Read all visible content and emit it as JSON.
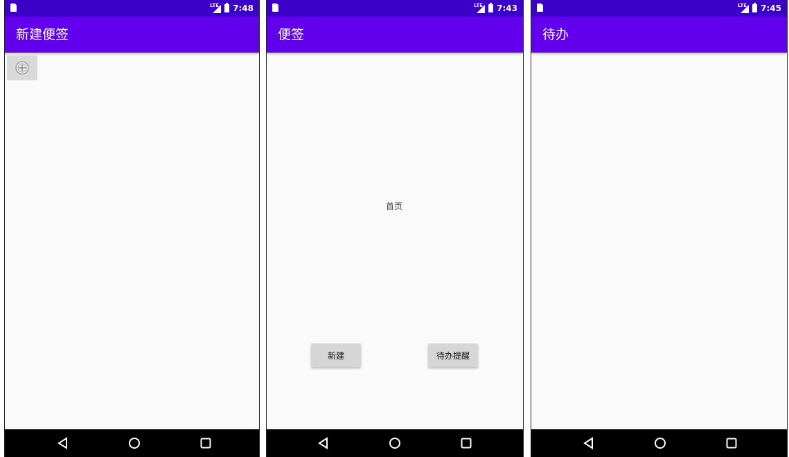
{
  "screens": [
    {
      "status": {
        "time": "7:48",
        "network": "LTE"
      },
      "title": "新建便签",
      "add_icon": "add-circle-icon"
    },
    {
      "status": {
        "time": "7:43",
        "network": "LTE"
      },
      "title": "便签",
      "home_text": "首页",
      "buttons": {
        "new": "新建",
        "todo": "待办提醒"
      }
    },
    {
      "status": {
        "time": "7:45",
        "network": "LTE"
      },
      "title": "待办"
    }
  ],
  "colors": {
    "statusbar": "#3d00c8",
    "appbar": "#6200ee",
    "navbar": "#000000",
    "background": "#fafafa"
  },
  "nav_icons": [
    "back-triangle-icon",
    "home-circle-icon",
    "recents-square-icon"
  ]
}
